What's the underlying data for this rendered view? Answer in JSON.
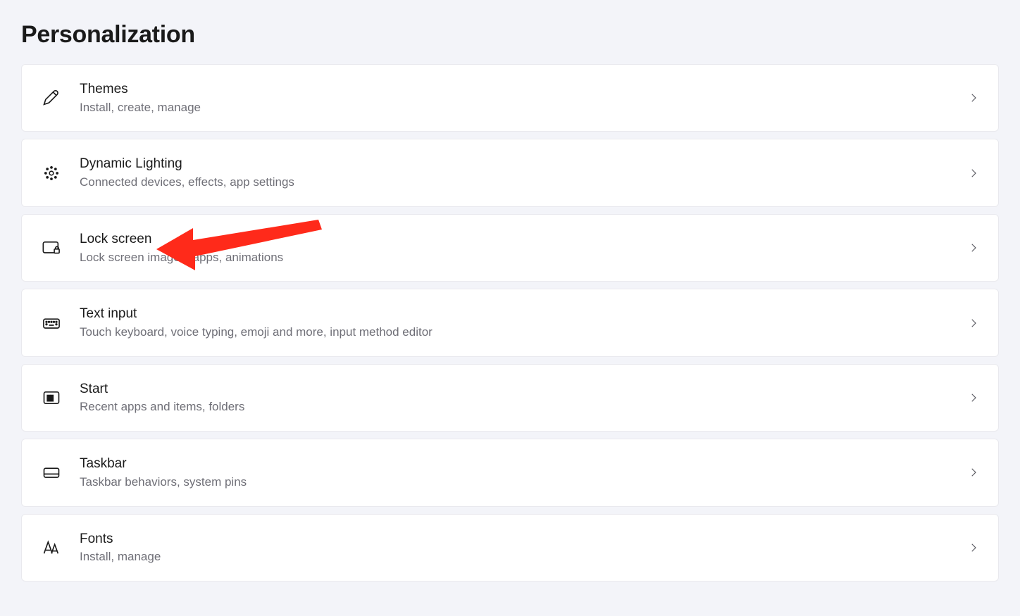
{
  "page": {
    "title": "Personalization"
  },
  "items": [
    {
      "key": "themes",
      "icon": "paintbrush-icon",
      "title": "Themes",
      "subtitle": "Install, create, manage"
    },
    {
      "key": "lighting",
      "icon": "dynamic-lighting-icon",
      "title": "Dynamic Lighting",
      "subtitle": "Connected devices, effects, app settings"
    },
    {
      "key": "lock",
      "icon": "lock-screen-icon",
      "title": "Lock screen",
      "subtitle": "Lock screen images, apps, animations"
    },
    {
      "key": "text",
      "icon": "keyboard-icon",
      "title": "Text input",
      "subtitle": "Touch keyboard, voice typing, emoji and more, input method editor"
    },
    {
      "key": "start",
      "icon": "start-icon",
      "title": "Start",
      "subtitle": "Recent apps and items, folders"
    },
    {
      "key": "taskbar",
      "icon": "taskbar-icon",
      "title": "Taskbar",
      "subtitle": "Taskbar behaviors, system pins"
    },
    {
      "key": "fonts",
      "icon": "fonts-icon",
      "title": "Fonts",
      "subtitle": "Install, manage"
    }
  ],
  "annotation": {
    "target": "lock",
    "color": "#ff2a1a"
  }
}
